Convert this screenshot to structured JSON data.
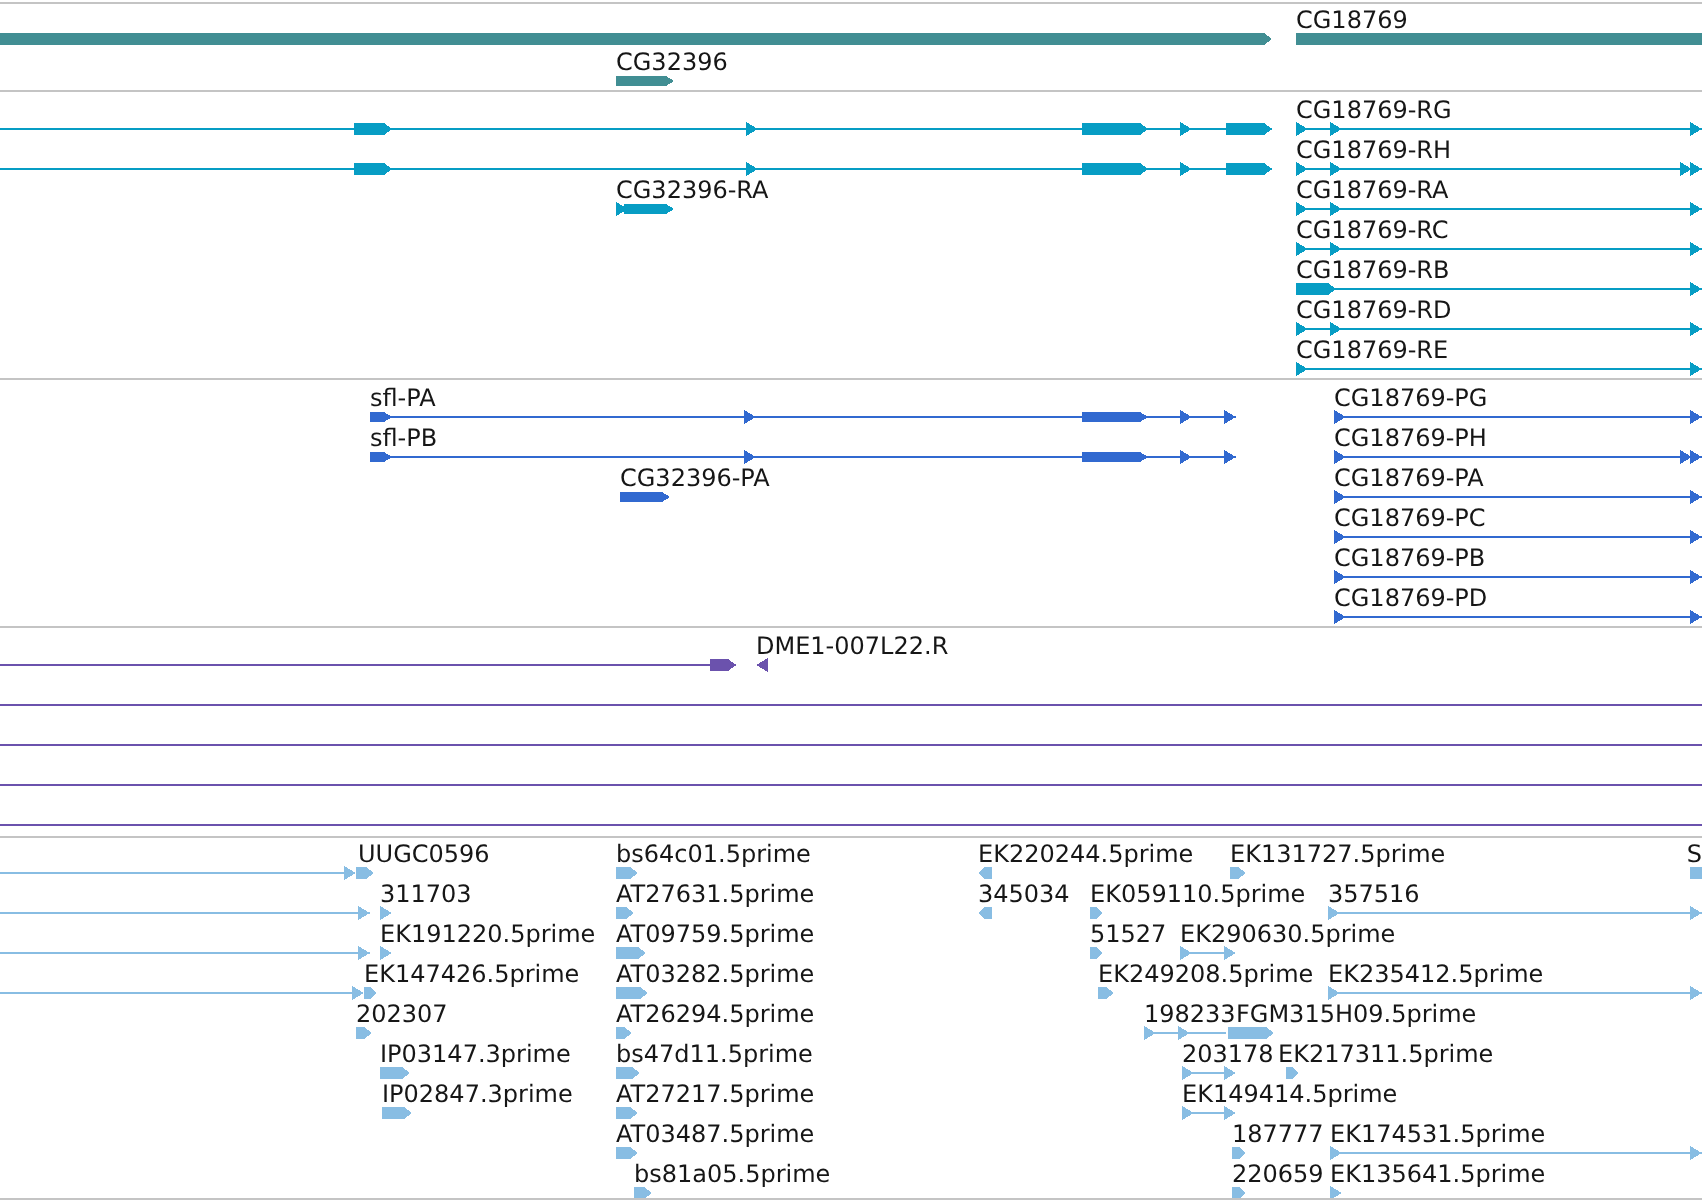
{
  "tracks": [
    {
      "kind": "gene",
      "features": [
        {
          "label": "CG18769",
          "reverse": false
        },
        {
          "reverse": false
        },
        {
          "label": "CG32396",
          "reverse": false
        }
      ]
    },
    {
      "kind": "transcript",
      "features": [
        {
          "reverse": false
        },
        {
          "label": "CG18769-RG",
          "reverse": false
        },
        {
          "reverse": false
        },
        {
          "label": "CG18769-RH",
          "reverse": false
        },
        {
          "label": "CG32396-RA",
          "reverse": false
        },
        {
          "label": "CG18769-RA",
          "reverse": false
        },
        {
          "label": "CG18769-RC",
          "reverse": false
        },
        {
          "label": "CG18769-RB",
          "reverse": false
        },
        {
          "label": "CG18769-RD",
          "reverse": false
        },
        {
          "label": "CG18769-RE",
          "reverse": false
        }
      ]
    },
    {
      "kind": "protein",
      "features": [
        {
          "label": "sfl-PA",
          "reverse": false
        },
        {
          "label": "CG18769-PG",
          "reverse": false
        },
        {
          "label": "sfl-PB",
          "reverse": false
        },
        {
          "label": "CG18769-PH",
          "reverse": false
        },
        {
          "label": "CG32396-PA",
          "reverse": false
        },
        {
          "label": "CG18769-PA",
          "reverse": false
        },
        {
          "label": "CG18769-PC",
          "reverse": false
        },
        {
          "label": "CG18769-PB",
          "reverse": false
        },
        {
          "label": "CG18769-PD",
          "reverse": false
        }
      ]
    },
    {
      "kind": "clone",
      "features": [
        {
          "reverse": false
        },
        {
          "label": "DME1-007L22.R",
          "reverse": true
        }
      ]
    },
    {
      "kind": "est",
      "features": [
        {
          "reverse": false
        },
        {
          "label": "UUGC0596",
          "reverse": false
        },
        {
          "label": "bs64c01.5prime",
          "reverse": false
        },
        {
          "label": "EK220244.5prime",
          "reverse": true
        },
        {
          "label": "EK131727.5prime",
          "reverse": false
        },
        {
          "label": "S",
          "reverse": false
        },
        {
          "reverse": false
        },
        {
          "label": "311703",
          "reverse": false
        },
        {
          "label": "AT27631.5prime",
          "reverse": false
        },
        {
          "label": "345034",
          "reverse": true
        },
        {
          "label": "EK059110.5prime",
          "reverse": false
        },
        {
          "label": "357516",
          "reverse": false
        },
        {
          "reverse": false
        },
        {
          "label": "EK191220.5prime",
          "reverse": false
        },
        {
          "label": "AT09759.5prime",
          "reverse": false
        },
        {
          "label": "51527",
          "reverse": false
        },
        {
          "label": "EK290630.5prime",
          "reverse": false
        },
        {
          "reverse": false
        },
        {
          "label": "EK147426.5prime",
          "reverse": false
        },
        {
          "label": "AT03282.5prime",
          "reverse": false
        },
        {
          "label": "EK249208.5prime",
          "reverse": false
        },
        {
          "label": "EK235412.5prime",
          "reverse": false
        },
        {
          "label": "202307",
          "reverse": false
        },
        {
          "label": "AT26294.5prime",
          "reverse": false
        },
        {
          "label": "198233",
          "reverse": false
        },
        {
          "label": "FGM315H09.5prime",
          "reverse": false
        },
        {
          "label": "IP03147.3prime",
          "reverse": false
        },
        {
          "label": "bs47d11.5prime",
          "reverse": false
        },
        {
          "label": "203178",
          "reverse": false
        },
        {
          "label": "EK217311.5prime",
          "reverse": false
        },
        {
          "label": "IP02847.3prime",
          "reverse": false
        },
        {
          "label": "AT27217.5prime",
          "reverse": false
        },
        {
          "label": "EK149414.5prime",
          "reverse": false
        },
        {
          "label": "AT03487.5prime",
          "reverse": false
        },
        {
          "label": "187777",
          "reverse": false
        },
        {
          "label": "EK174531.5prime",
          "reverse": false
        },
        {
          "label": "bs81a05.5prime",
          "reverse": false
        },
        {
          "label": "220659",
          "reverse": false
        },
        {
          "label": "EK135641.5prime",
          "reverse": false
        }
      ]
    }
  ]
}
